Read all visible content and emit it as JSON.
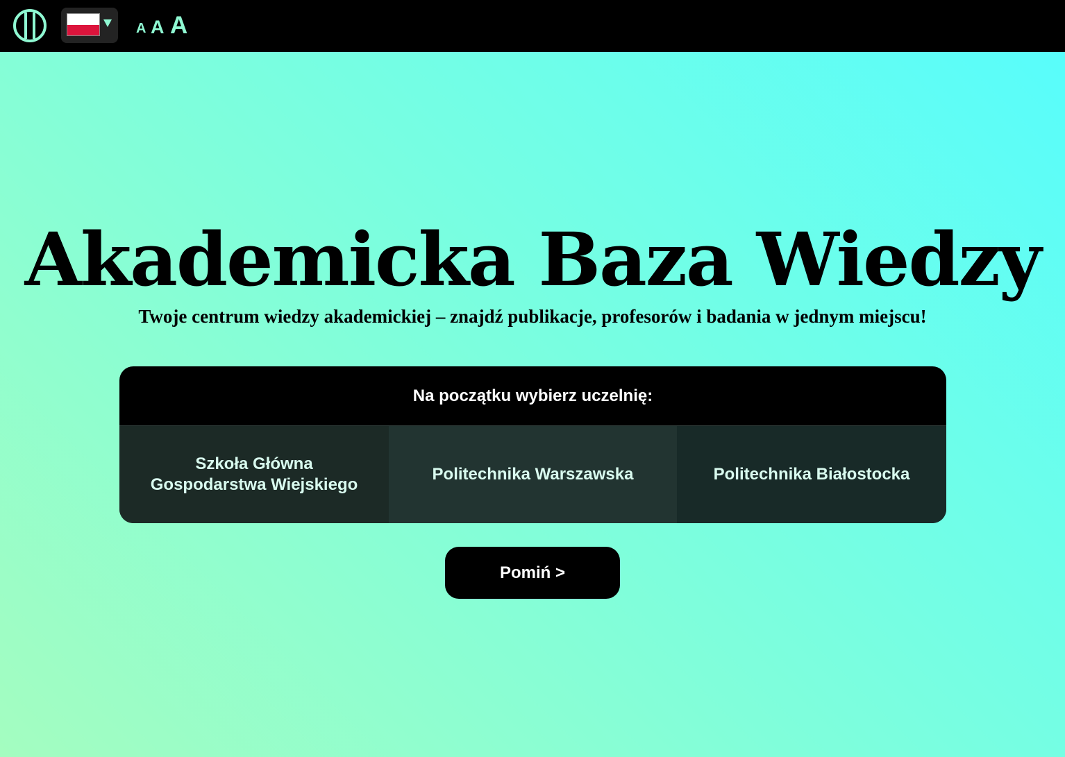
{
  "topbar": {
    "contrast_icon": "contrast-toggle-icon",
    "language": {
      "selected": "Polski",
      "flag": "flag-pl-icon",
      "caret": "caret-down-icon"
    },
    "font_sizes": [
      "A",
      "A",
      "A"
    ]
  },
  "hero": {
    "title": "Akademicka Baza Wiedzy",
    "subtitle": "Twoje centrum wiedzy akademickiej – znajdź publikacje, profesorów i badania w jednym miejscu!"
  },
  "university_selector": {
    "header": "Na początku wybierz uczelnię:",
    "options": [
      {
        "line1": "Szkoła Główna",
        "line2": "Gospodarstwa Wiejskiego"
      },
      {
        "line1": "Politechnika Warszawska"
      },
      {
        "line1": "Politechnika Białostocka"
      }
    ]
  },
  "skip_button": "Pomiń >",
  "colors": {
    "accent": "#8ff8d2",
    "bar": "#000000",
    "gradient_start": "#a4fdc0",
    "gradient_end": "#56fdfd",
    "flag_white": "#ffffff",
    "flag_red": "#dc143c"
  }
}
